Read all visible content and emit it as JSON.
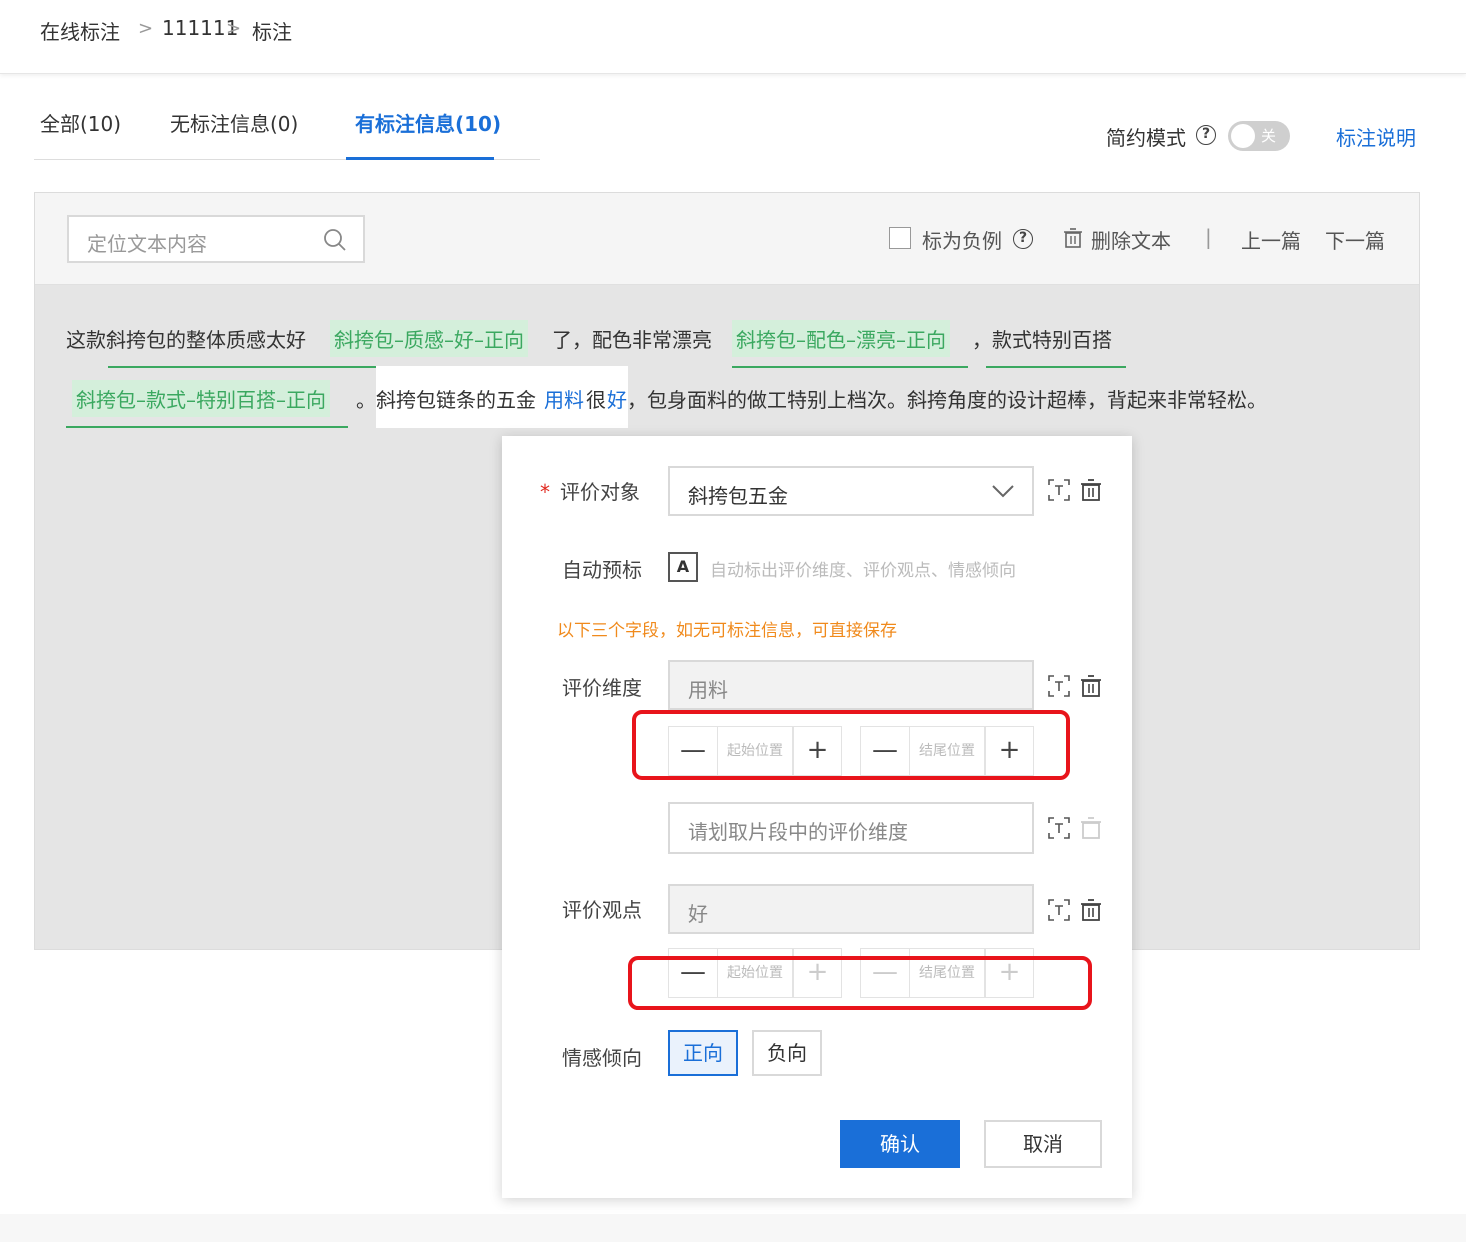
{
  "breadcrumb": [
    "在线标注",
    "111111",
    "标注"
  ],
  "tabs": [
    {
      "label": "全部(10)"
    },
    {
      "label": "无标注信息(0)"
    },
    {
      "label": "有标注信息(10)"
    }
  ],
  "header_right": {
    "simple_mode": "简约模式",
    "toggle_text": "关",
    "help_link": "标注说明"
  },
  "toolbar": {
    "search_placeholder": "定位文本内容",
    "mark_negative": "标为负例",
    "delete_text": "删除文本",
    "prev": "上一篇",
    "next": "下一篇",
    "divider": "|"
  },
  "text": {
    "s1": "这款斜挎包的整体质感太好",
    "tag1": "斜挎包–质感–好–正向",
    "s2": "了，配色非常漂亮",
    "tag2": "斜挎包–配色–漂亮–正向",
    "s3": "，款式特别百搭",
    "tag3": "斜挎包–款式–特别百搭–正向",
    "s4a": "。斜挎包链条的五金",
    "s4b": "用料",
    "s4c": "很",
    "s4d": "好",
    "s4e": "，包身面料的做工特别上档次。斜挎角度的设计超棒，背起来非常轻松。"
  },
  "popup": {
    "target_label": "评价对象",
    "target_required": "*",
    "target_value": "斜挎包五金",
    "auto_label": "自动预标",
    "auto_icon": "A",
    "auto_text": "自动标出评价维度、评价观点、情感倾向",
    "note": "以下三个字段，如无可标注信息，可直接保存",
    "dimension_label": "评价维度",
    "dimension_value": "用料",
    "start_pos": "起始位置",
    "end_pos": "结尾位置",
    "dimension_placeholder": "请划取片段中的评价维度",
    "opinion_label": "评价观点",
    "opinion_value": "好",
    "sentiment_label": "情感倾向",
    "positive": "正向",
    "negative": "负向",
    "confirm": "确认",
    "cancel": "取消"
  },
  "colors": {
    "accent": "#1a6fd8",
    "tag_green": "#3ba860",
    "warning": "#f08a1c",
    "highlight_red": "#e8141b"
  }
}
